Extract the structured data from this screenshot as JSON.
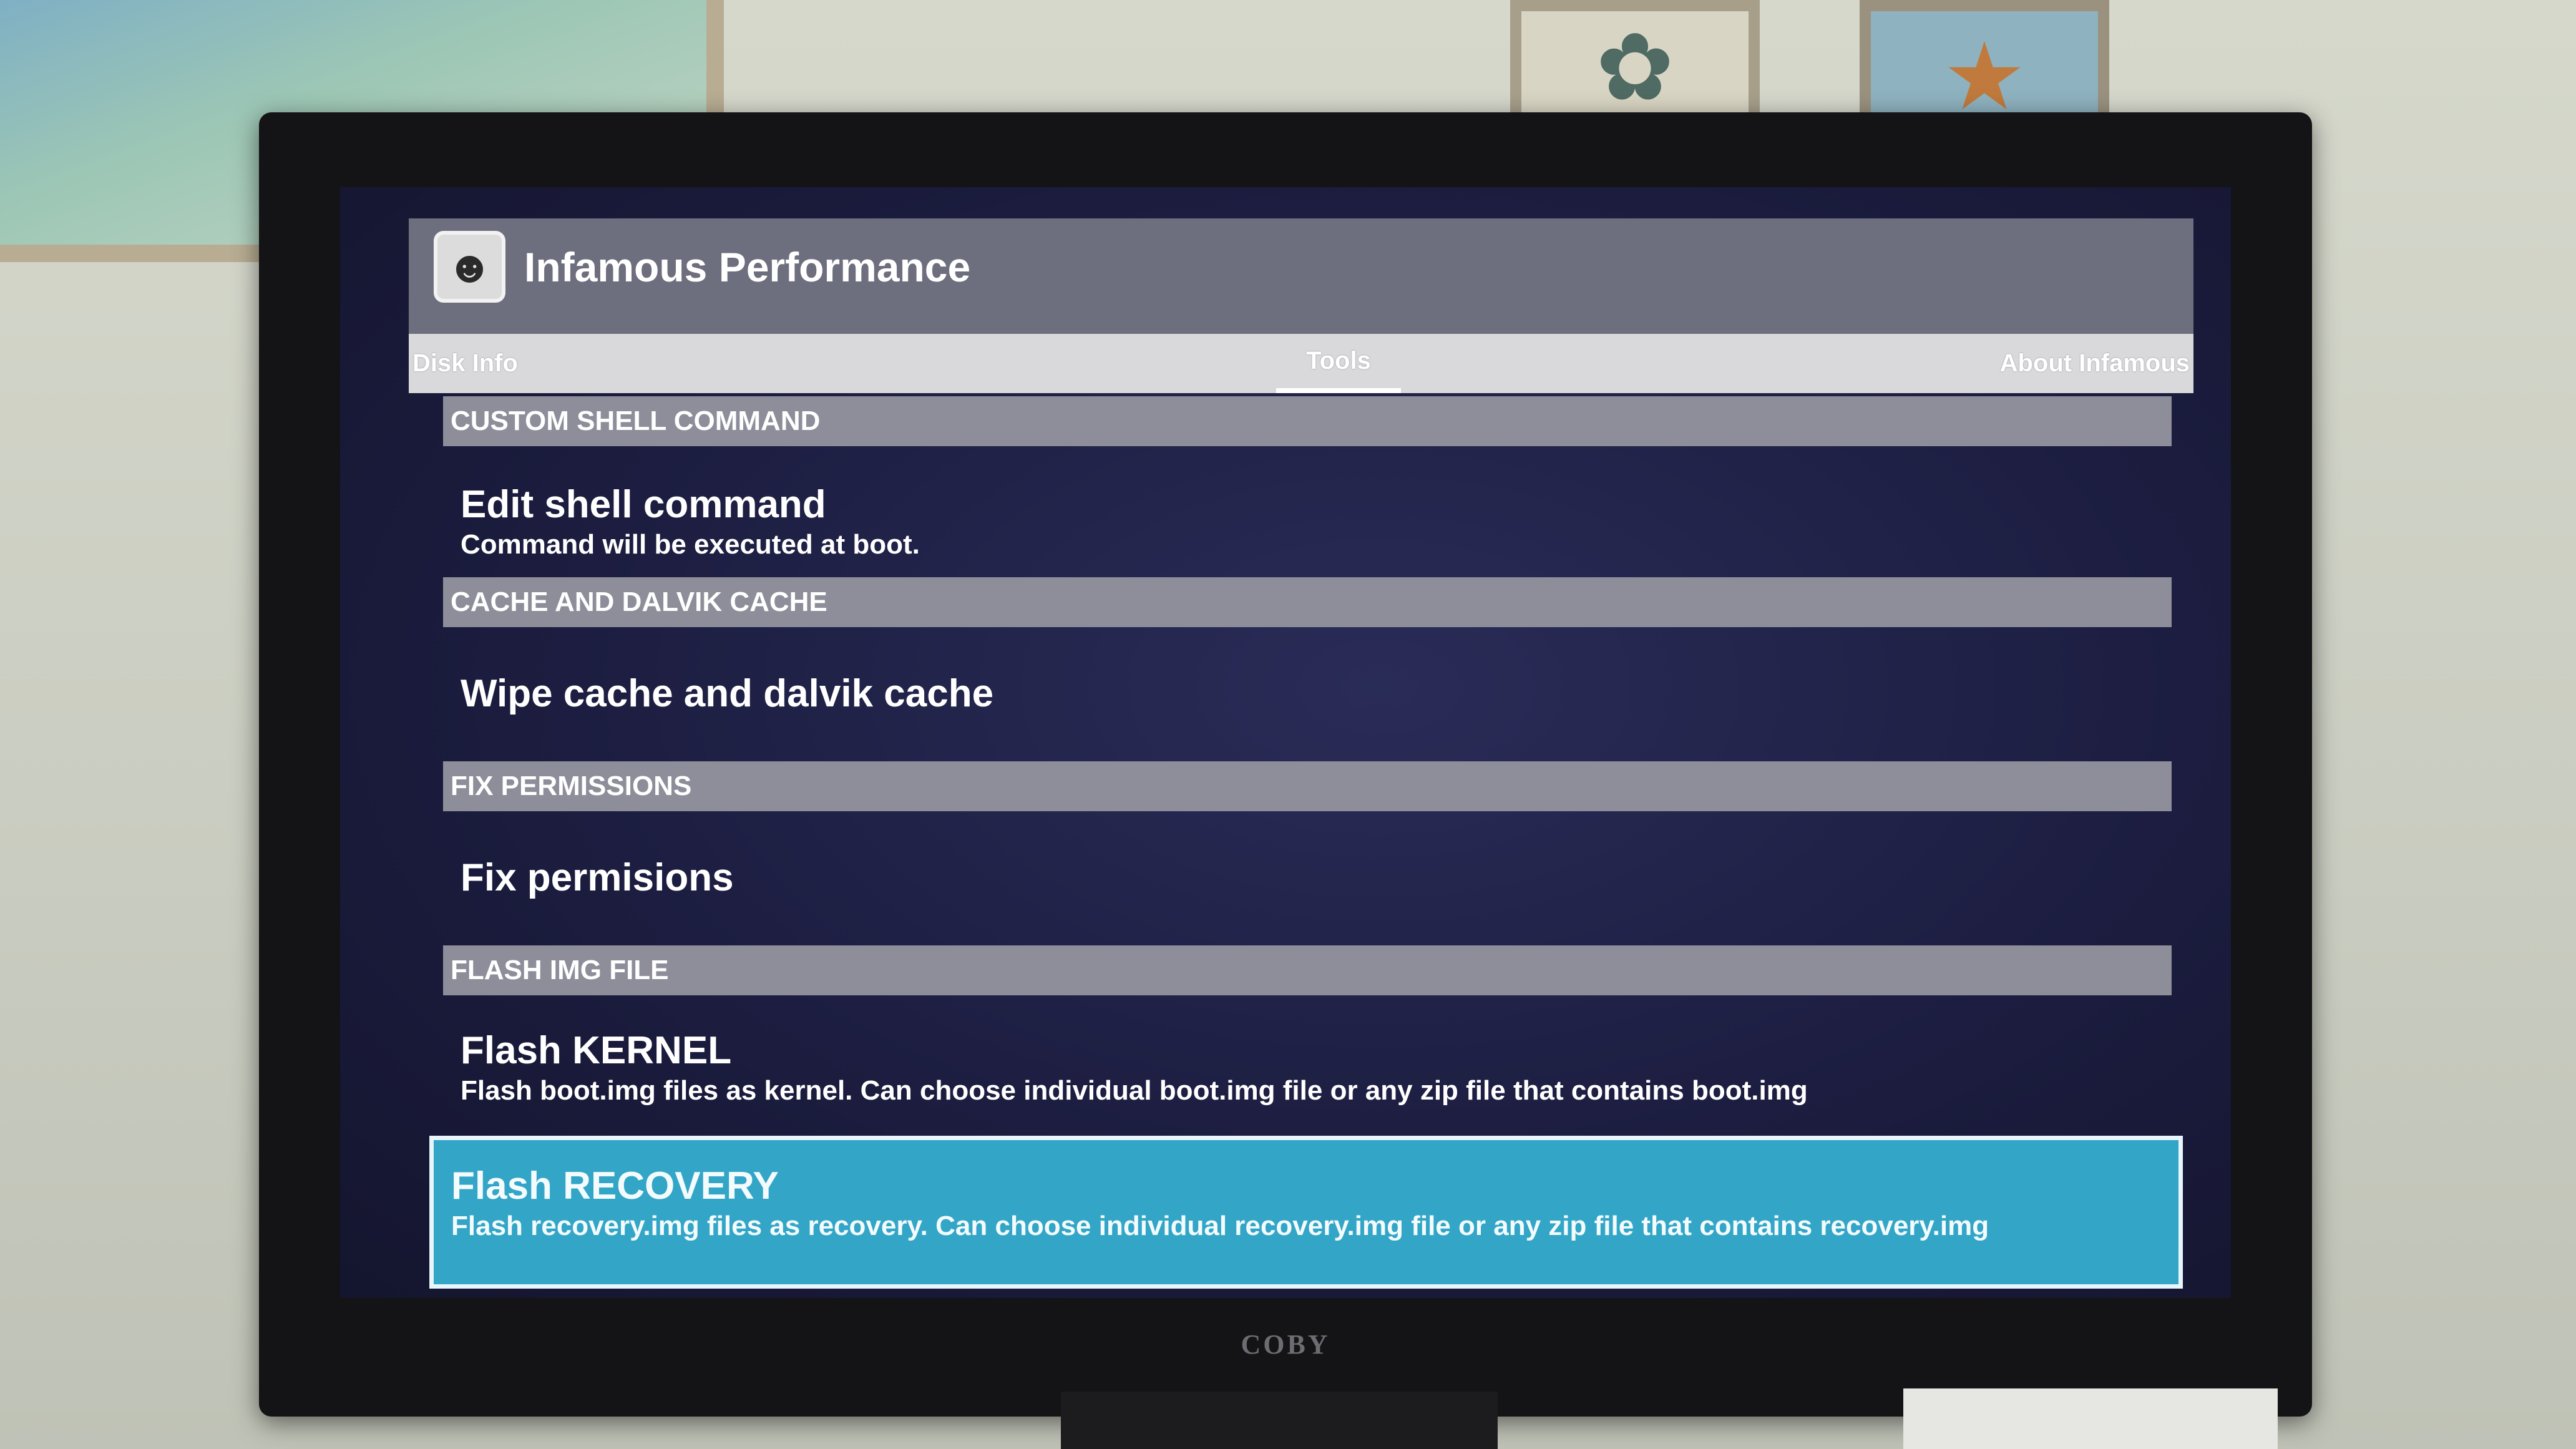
{
  "app": {
    "title": "Infamous Performance",
    "logo_icon": "masked-face-icon"
  },
  "tabs": [
    {
      "label": "Disk Info"
    },
    {
      "label": "Tools",
      "selected": true
    },
    {
      "label": "About Infamous"
    }
  ],
  "sections": [
    {
      "header": "CUSTOM SHELL COMMAND",
      "item": {
        "title": "Edit shell command",
        "summary": "Command will be executed at boot."
      }
    },
    {
      "header": "CACHE AND DALVIK CACHE",
      "item": {
        "title": "Wipe cache and dalvik cache",
        "summary": ""
      }
    },
    {
      "header": "FIX PERMISSIONS",
      "item": {
        "title": "Fix permisions",
        "summary": ""
      }
    },
    {
      "header": "FLASH IMG FILE",
      "items": [
        {
          "title": "Flash KERNEL",
          "summary": "Flash boot.img files as kernel. Can choose individual boot.img file or any zip file that contains boot.img"
        },
        {
          "title": "Flash RECOVERY",
          "summary": "Flash recovery.img files as recovery. Can choose individual recovery.img file or any zip file that contains recovery.img",
          "selected": true
        }
      ]
    }
  ],
  "tv": {
    "brand": "COBY"
  },
  "colors": {
    "action_bar": "#6e6f7e",
    "tab_bar": "#d9d9dc",
    "section_header": "#8d8e9a",
    "selected_item": "#33a6c8",
    "screen_background": "#1c1d40"
  }
}
